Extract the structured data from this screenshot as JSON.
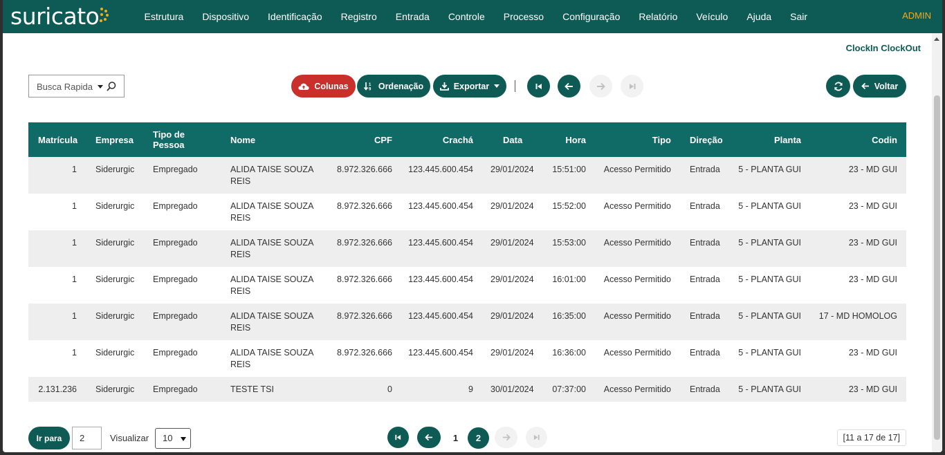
{
  "header": {
    "logo": "suricato",
    "menu": [
      "Estrutura",
      "Dispositivo",
      "Identificação",
      "Registro",
      "Entrada",
      "Controle",
      "Processo",
      "Configuração",
      "Relatório",
      "Veículo",
      "Ajuda",
      "Sair"
    ],
    "user": "ADMIN"
  },
  "page": {
    "subtitle": "ClockIn ClockOut"
  },
  "toolbar": {
    "search_placeholder": "Busca Rapida",
    "columns_label": "Colunas",
    "order_label": "Ordenação",
    "export_label": "Exportar",
    "back_label": "Voltar"
  },
  "table": {
    "headers": {
      "matricula": "Matrícula",
      "empresa": "Empresa",
      "tipo_pessoa": "Tipo de Pessoa",
      "nome": "Nome",
      "cpf": "CPF",
      "cracha": "Crachá",
      "data": "Data",
      "hora": "Hora",
      "tipo": "Tipo",
      "direcao": "Direção",
      "planta": "Planta",
      "codin": "Codin"
    },
    "rows": [
      {
        "matricula": "1",
        "empresa": "Siderurgic",
        "tipo_pessoa": "Empregado",
        "nome": "ALIDA TAISE SOUZA REIS",
        "cpf": "8.972.326.666",
        "cracha": "123.445.600.454",
        "data": "29/01/2024",
        "hora": "15:51:00",
        "tipo": "Acesso Permitido",
        "direcao": "Entrada",
        "planta": "5 - PLANTA GUI",
        "codin": "23 - MD GUI"
      },
      {
        "matricula": "1",
        "empresa": "Siderurgic",
        "tipo_pessoa": "Empregado",
        "nome": "ALIDA TAISE SOUZA REIS",
        "cpf": "8.972.326.666",
        "cracha": "123.445.600.454",
        "data": "29/01/2024",
        "hora": "15:52:00",
        "tipo": "Acesso Permitido",
        "direcao": "Entrada",
        "planta": "5 - PLANTA GUI",
        "codin": "23 - MD GUI"
      },
      {
        "matricula": "1",
        "empresa": "Siderurgic",
        "tipo_pessoa": "Empregado",
        "nome": "ALIDA TAISE SOUZA REIS",
        "cpf": "8.972.326.666",
        "cracha": "123.445.600.454",
        "data": "29/01/2024",
        "hora": "15:53:00",
        "tipo": "Acesso Permitido",
        "direcao": "Entrada",
        "planta": "5 - PLANTA GUI",
        "codin": "23 - MD GUI"
      },
      {
        "matricula": "1",
        "empresa": "Siderurgic",
        "tipo_pessoa": "Empregado",
        "nome": "ALIDA TAISE SOUZA REIS",
        "cpf": "8.972.326.666",
        "cracha": "123.445.600.454",
        "data": "29/01/2024",
        "hora": "16:01:00",
        "tipo": "Acesso Permitido",
        "direcao": "Entrada",
        "planta": "5 - PLANTA GUI",
        "codin": "23 - MD GUI"
      },
      {
        "matricula": "1",
        "empresa": "Siderurgic",
        "tipo_pessoa": "Empregado",
        "nome": "ALIDA TAISE SOUZA REIS",
        "cpf": "8.972.326.666",
        "cracha": "123.445.600.454",
        "data": "29/01/2024",
        "hora": "16:35:00",
        "tipo": "Acesso Permitido",
        "direcao": "Entrada",
        "planta": "5 - PLANTA GUI",
        "codin": "17 - MD HOMOLOG"
      },
      {
        "matricula": "1",
        "empresa": "Siderurgic",
        "tipo_pessoa": "Empregado",
        "nome": "ALIDA TAISE SOUZA REIS",
        "cpf": "8.972.326.666",
        "cracha": "123.445.600.454",
        "data": "29/01/2024",
        "hora": "16:36:00",
        "tipo": "Acesso Permitido",
        "direcao": "Entrada",
        "planta": "5 - PLANTA GUI",
        "codin": "23 - MD GUI"
      },
      {
        "matricula": "2.131.236",
        "empresa": "Siderurgic",
        "tipo_pessoa": "Empregado",
        "nome": "TESTE TSI",
        "cpf": "0",
        "cracha": "9",
        "data": "30/01/2024",
        "hora": "07:37:00",
        "tipo": "Acesso Permitido",
        "direcao": "Entrada",
        "planta": "5 - PLANTA GUI",
        "codin": "23 - MD GUI"
      }
    ]
  },
  "pagination": {
    "go_to_label": "Ir para",
    "go_to_value": "2",
    "view_label": "Visualizar",
    "page_size": "10",
    "pages": [
      "1",
      "2"
    ],
    "current_page": "2",
    "range_text": "[11 a 17 de 17]"
  },
  "colors": {
    "primary": "#0e5b55",
    "header_row": "#106b67",
    "danger": "#c9302c",
    "admin": "#f0ac1e"
  }
}
